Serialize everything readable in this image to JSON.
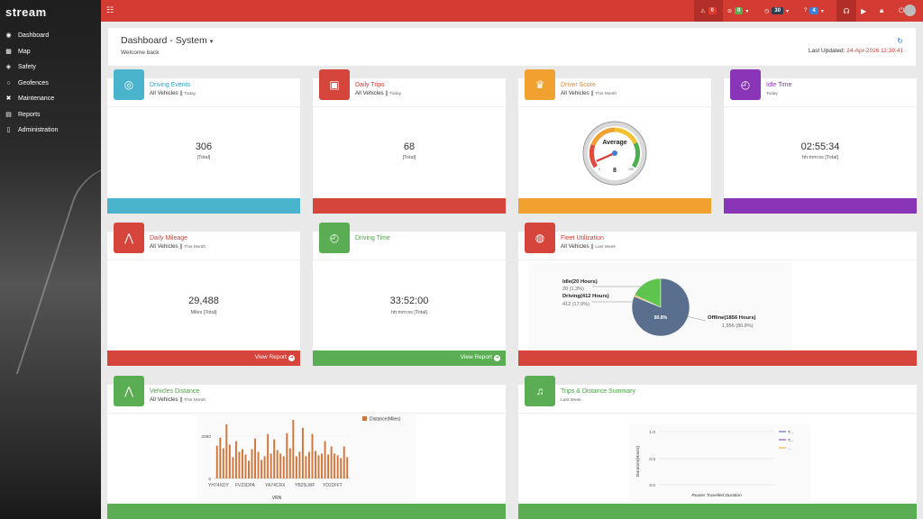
{
  "app": {
    "logo": "stream"
  },
  "sidebar": {
    "items": [
      {
        "label": "Dashboard",
        "icon": "speedometer-icon"
      },
      {
        "label": "Map",
        "icon": "map-icon"
      },
      {
        "label": "Safety",
        "icon": "shield-icon"
      },
      {
        "label": "Geofences",
        "icon": "circle-icon"
      },
      {
        "label": "Maintenance",
        "icon": "wrench-icon"
      },
      {
        "label": "Reports",
        "icon": "chart-icon"
      },
      {
        "label": "Administration",
        "icon": "document-icon"
      }
    ]
  },
  "topbar": {
    "alerts_count": "0",
    "messages_count": "0",
    "clock_count": "30",
    "help_count": "4"
  },
  "header": {
    "title": "Dashboard - System",
    "welcome": "Welcome back",
    "updated_label": "Last Updated:",
    "updated_value": "24-Apr-2026 11:39:41"
  },
  "cards": {
    "driving_events": {
      "title": "Driving Events",
      "sub": "All Vehicles || ",
      "period": "Today",
      "value": "306",
      "unit": "[Total]"
    },
    "daily_trips": {
      "title": "Daily Trips",
      "sub": "All Vehicles || ",
      "period": "Today",
      "value": "68",
      "unit": "[Total]"
    },
    "driver_score": {
      "title": "Driver Score",
      "sub": "All Vehicles || ",
      "period": "This Month",
      "gauge_label": "Average",
      "gauge_value": "8",
      "gauge_min": "0",
      "gauge_max": "100",
      "score": 8
    },
    "idle_time": {
      "title": "Idle Time",
      "period": "Today",
      "value": "02:55:34",
      "unit": "hh:mm:ss [Total]"
    },
    "daily_mileage": {
      "title": "Daily Mileage",
      "sub": "All Vehicles || ",
      "period": "This Month",
      "value": "29,488",
      "unit": "Miles [Total]",
      "link": "View Report"
    },
    "driving_time": {
      "title": "Driving Time",
      "value": "33:52:00",
      "unit": "hh:mm:ss [Total]",
      "link": "View Report"
    },
    "fleet_utilization": {
      "title": "Fleet Utilization",
      "sub": "All Vehicles || ",
      "period": "Last Week",
      "idle_label": "Idle(20 Hours)",
      "idle_value": "20 (1.3%)",
      "driving_label": "Driving(412 Hours)",
      "driving_value": "412 (17.9%)",
      "offline_label": "Offline(1856 Hours)",
      "offline_value": "1,856 (80.8%)",
      "center_label": "80.8%"
    },
    "vehicles_distance": {
      "title": "Vehicles Distance",
      "sub": "All Vehicles || ",
      "period": "This Month",
      "legend": "Distance(Miles)",
      "xlabel": "VRN"
    },
    "trips_distance": {
      "title": "Trips & Distance Summary",
      "period": "Last Week",
      "ylabel": "Duration(Hours)",
      "xlabel": "Routes Travelled Duration",
      "legend": [
        "T...",
        "T...",
        "..."
      ]
    }
  },
  "colors": {
    "accent": "#d33b33",
    "blue": "#4bb4cd",
    "orange": "#f0a12f",
    "purple": "#8a34b8",
    "green": "#5aad52",
    "pie_offline": "#5a6f8e",
    "pie_driving": "#5ec44e",
    "pie_idle": "#f0a12f",
    "bar": "#d3743a"
  },
  "chart_data": [
    {
      "type": "pie",
      "categories": [
        "Idle(20 Hours)",
        "Driving(412 Hours)",
        "Offline(1856 Hours)"
      ],
      "values": [
        20,
        412,
        1856
      ],
      "percent_labels": [
        "1.3%",
        "17.9%",
        "80.8%"
      ]
    },
    {
      "type": "bar",
      "title": "Vehicles Distance",
      "xlabel": "VRN",
      "ylabel": "",
      "series": [
        {
          "name": "Distance(Miles)"
        }
      ],
      "tick_labels_x": [
        "YH74XDY",
        "FV23DPA",
        "YA74CRX",
        "YB25LWF",
        "YD22FFT"
      ],
      "yticks": [
        0,
        2080
      ],
      "ylim": [
        0,
        3400
      ],
      "values": [
        1850,
        2300,
        1700,
        3050,
        1900,
        1200,
        2100,
        1500,
        1650,
        1350,
        1000,
        1650,
        2250,
        1500,
        1050,
        1250,
        2500,
        1400,
        2200,
        1600,
        1400,
        1250,
        2550,
        1700,
        3300,
        1250,
        1500,
        2850,
        1250,
        1500,
        2500,
        1550,
        1300,
        1400,
        2100,
        1350,
        1800,
        1400,
        1300,
        1150,
        1800,
        1200
      ]
    },
    {
      "type": "line",
      "title": "",
      "xlabel": "Routes Travelled Duration",
      "ylabel": "Duration(Hours)",
      "yticks": [
        "0.0",
        "0.5",
        "1.0"
      ],
      "ylim": [
        0,
        1
      ],
      "series": [
        {
          "name": "T...",
          "color": "#3d5aa8"
        },
        {
          "name": "T...",
          "color": "#8a34b8"
        },
        {
          "name": "...",
          "color": "#f0a12f"
        }
      ]
    }
  ]
}
